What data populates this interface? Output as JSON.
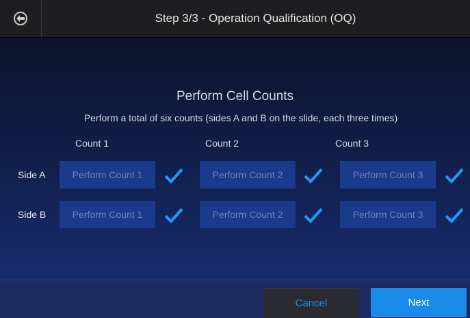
{
  "header": {
    "title": "Step 3/3 - Operation Qualification (OQ)",
    "back_icon": "back-arrow-circle-icon"
  },
  "main": {
    "title": "Perform Cell Counts",
    "subtitle": "Perform a total of six counts (sides A and B on the slide, each three times)",
    "columns": [
      "Count 1",
      "Count 2",
      "Count 3"
    ],
    "rows": [
      {
        "label": "Side A",
        "buttons": [
          "Perform Count 1",
          "Perform Count 2",
          "Perform Count 3"
        ],
        "completed": [
          true,
          true,
          true
        ]
      },
      {
        "label": "Side B",
        "buttons": [
          "Perform Count 1",
          "Perform Count 2",
          "Perform Count 3"
        ],
        "completed": [
          true,
          true,
          true
        ]
      }
    ]
  },
  "footer": {
    "cancel_label": "Cancel",
    "next_label": "Next"
  },
  "colors": {
    "accent": "#1a8ae8",
    "check": "#1e9bff",
    "disabled_button": "#1a3a8c"
  }
}
